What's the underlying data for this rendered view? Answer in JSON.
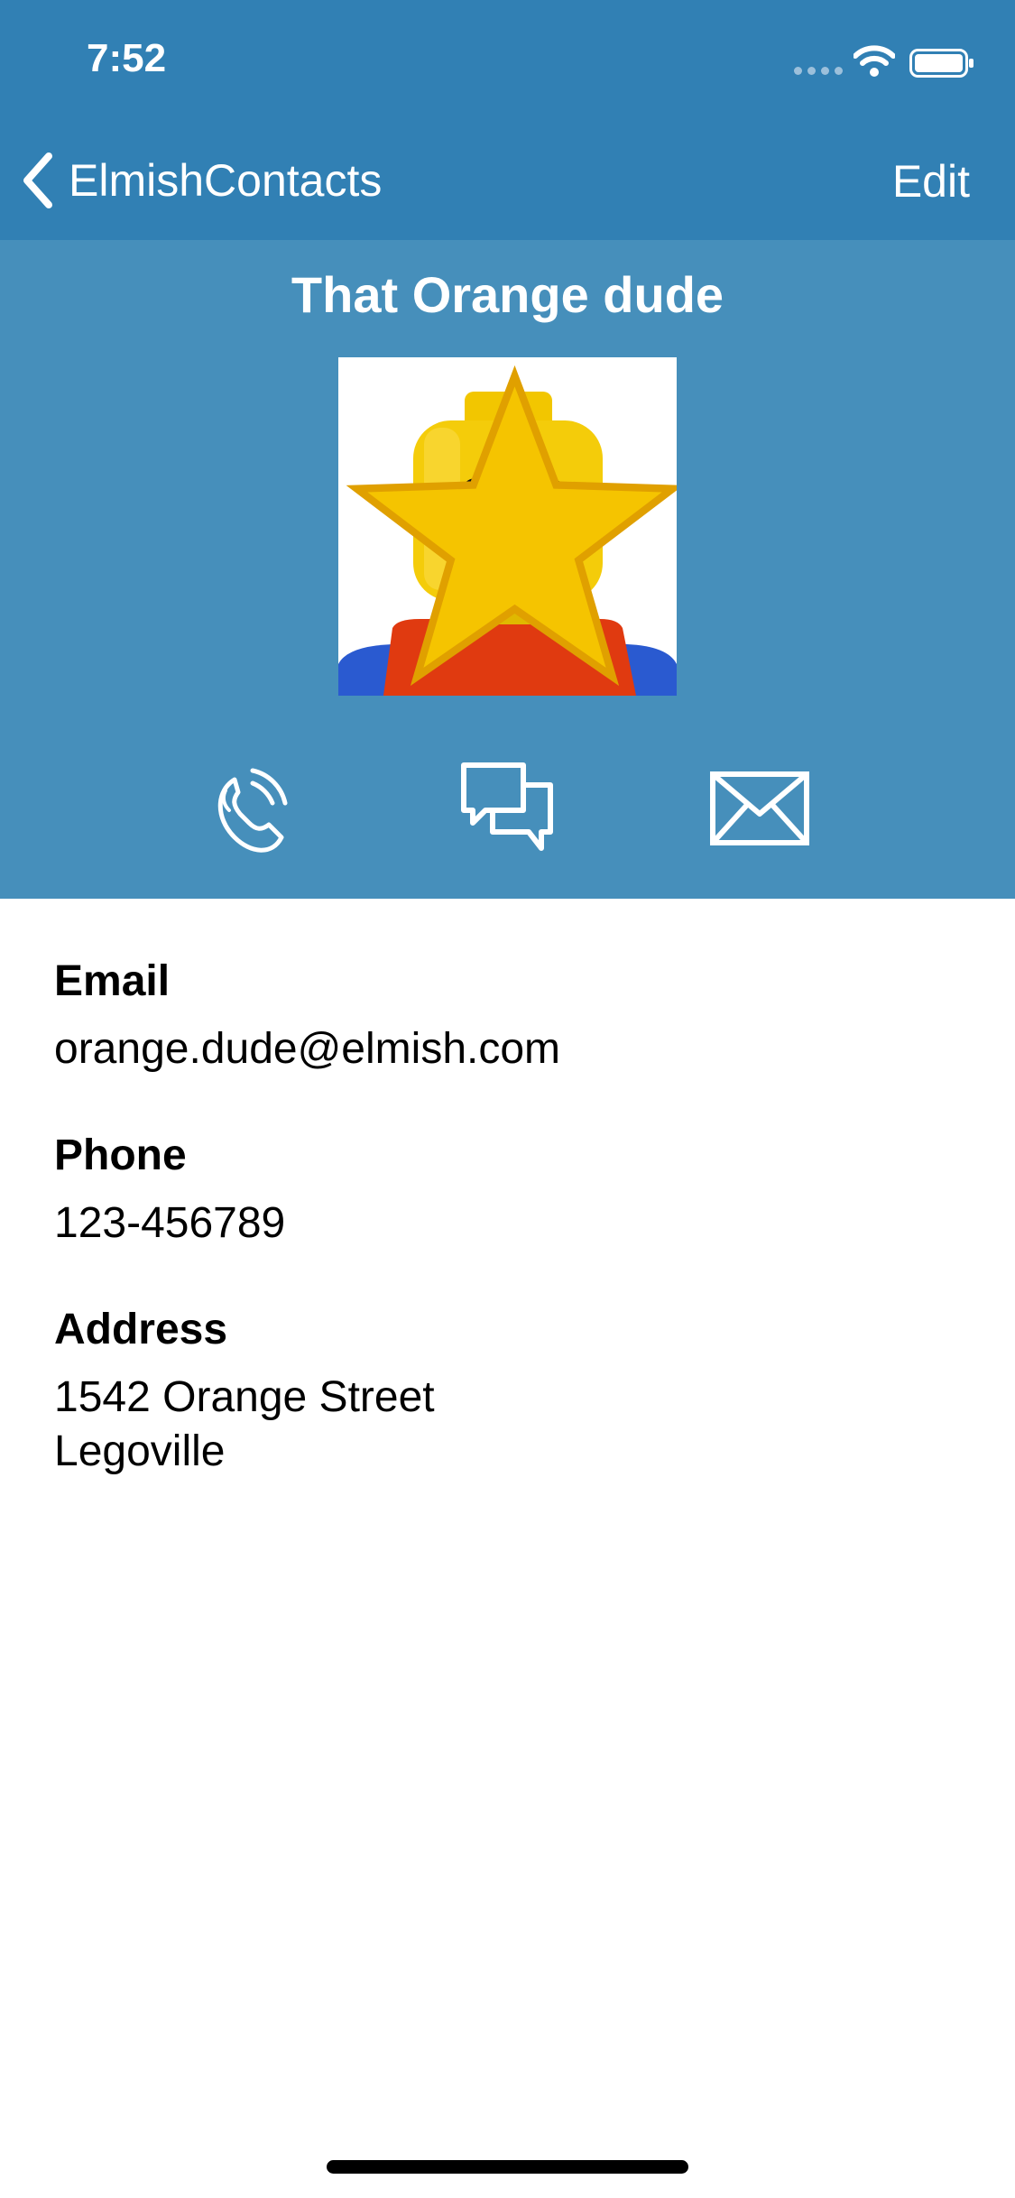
{
  "status_bar": {
    "time": "7:52"
  },
  "nav": {
    "back_label": "ElmishContacts",
    "edit_label": "Edit"
  },
  "contact": {
    "name": "That Orange dude",
    "is_favorite": true,
    "photo_icon": "lego-minifigure-photo"
  },
  "actions": [
    {
      "name": "call",
      "icon": "phone-icon"
    },
    {
      "name": "message",
      "icon": "chat-bubbles-icon"
    },
    {
      "name": "email",
      "icon": "envelope-icon"
    }
  ],
  "fields": {
    "email": {
      "label": "Email",
      "value": "orange.dude@elmish.com"
    },
    "phone": {
      "label": "Phone",
      "value": "123-456789"
    },
    "address": {
      "label": "Address",
      "line1": "1542 Orange Street",
      "line2": "Legoville"
    }
  },
  "colors": {
    "nav": "#3180b4",
    "header": "#468fbb",
    "star": "#f5c400"
  }
}
